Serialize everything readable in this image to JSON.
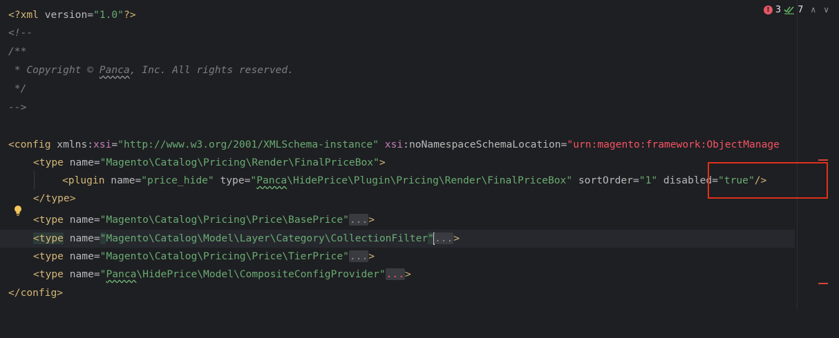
{
  "inspection": {
    "error_count": "3",
    "ok_count": "7",
    "error_icon": "exclamation-icon",
    "ok_icon": "double-check-icon",
    "up_icon": "chevron-up-icon",
    "down_icon": "chevron-down-icon"
  },
  "code": {
    "l1": {
      "open": "<?",
      "tag": "xml",
      "attr": " version",
      "eq": "=",
      "val": "\"1.0\"",
      "close": "?>"
    },
    "l2": "<!--",
    "l3": "/**",
    "l4a": " * Copyright © ",
    "l4b": "Panca",
    "l4c": ", Inc. All rights reserved.",
    "l5": " */",
    "l6": "-->",
    "l8": {
      "tag": "<config",
      "attr1": " xmlns:",
      "ns1": "xsi",
      "eq": "=",
      "val1": "\"http://www.w3.org/2001/XMLSchema-instance\"",
      "ns2": " xsi",
      "attr2": ":noNamespaceSchemaLocation",
      "eq2": "=",
      "val2": "\"urn:magento:framework:ObjectManage"
    },
    "l9": {
      "tag": "<type",
      "attr": " name",
      "eq": "=",
      "val": "\"Magento\\Catalog\\Pricing\\Render\\FinalPriceBox\"",
      "close": ">"
    },
    "l10": {
      "tag": "<plugin",
      "attr1": " name",
      "eq": "=",
      "val1": "\"price_hide\"",
      "attr2": " type",
      "val2a": "\"",
      "val2b": "Panca",
      "val2c": "\\HidePrice\\Plugin\\Pricing\\Render\\FinalPriceBox\"",
      "attr3": " sortOrder",
      "val3": "\"1\"",
      "attr4": " disabled",
      "val4": "\"true\"",
      "close": "/>"
    },
    "l11": "</type>",
    "l12": {
      "tag": "<type",
      "attr": " name",
      "eq": "=",
      "val": "\"Magento\\Catalog\\Pricing\\Price\\BasePrice\"",
      "fold": "...",
      "close": ">"
    },
    "l13": {
      "tag": "<type",
      "attr": " name",
      "eq": "=",
      "q1": "\"",
      "val": "Magento\\Catalog\\Model\\Layer\\Category\\CollectionFilter",
      "q2": "\"",
      "fold": "...",
      "close": ">"
    },
    "l14": {
      "tag": "<type",
      "attr": " name",
      "eq": "=",
      "val": "\"Magento\\Catalog\\Pricing\\Price\\TierPrice\"",
      "fold": "...",
      "close": ">"
    },
    "l15": {
      "tag": "<type",
      "attr": " name",
      "eq": "=",
      "qa": "\"",
      "vb": "Panca",
      "vc": "\\HidePrice\\Model\\CompositeConfigProvider\"",
      "fold": "...",
      "close": ">"
    },
    "l16": "</config>"
  },
  "colors": {
    "background": "#1e1f22",
    "tag": "#d5b778",
    "value": "#6aab73",
    "comment": "#7a7e85",
    "annotation_box": "#e0311c",
    "error": "#e55765"
  }
}
